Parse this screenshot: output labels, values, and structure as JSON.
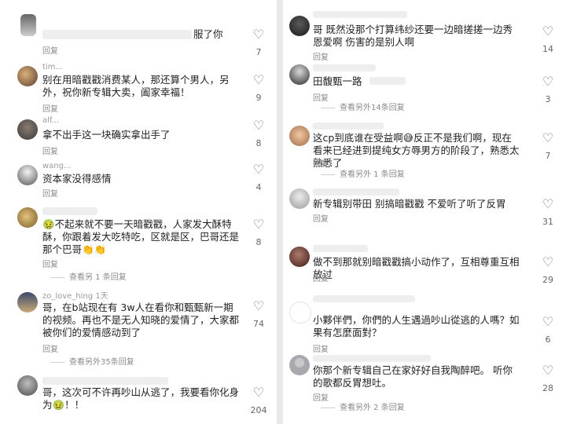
{
  "labels": {
    "reply": "回复",
    "heart_glyph": "♡"
  },
  "left_comments": [
    {
      "username": "",
      "text": "服了你",
      "likes": "7",
      "more": ""
    },
    {
      "username": "tim...",
      "text": "别在用暗戳戳消费某人，那还算个男人，另外，祝你新专辑大卖，阖家幸福！",
      "likes": "9",
      "more": ""
    },
    {
      "username": "alf...",
      "text": "拿不出手这一块确实拿出手了",
      "likes": "8",
      "more": ""
    },
    {
      "username": "wang...",
      "text": "资本家没得感情",
      "likes": "4",
      "more": ""
    },
    {
      "username": "",
      "text": "🤢不起来就不要一天暗戳戳，人家发大酥特酥，你跟着发大吃特吃，区就是区，巴哥还是那个巴哥👏👏",
      "likes": "8",
      "more": "查看另 1 条回复"
    },
    {
      "username": "zo_love_hing 1天",
      "text": "哥，在b站现在有 3w人在看你和甄甄新一期的视频。再也不是无人知晓的爱情了，大家都被你们的爱情感动到了",
      "likes": "74",
      "more": "查看另外35条回复"
    },
    {
      "username": "",
      "text": "哥，这次可不许再吵山从逃了，我要看你化身为🤢！！",
      "likes": "204",
      "more": ""
    }
  ],
  "right_comments": [
    {
      "username": "",
      "text": "哥 既然没那个打算纬纱还要一边暗搓搓一边秀恩爱啊 伤害的是别人啊",
      "likes": "14",
      "more": ""
    },
    {
      "username": "",
      "text": "田馥甄一路",
      "likes": "3",
      "more": "查看另外14条回复"
    },
    {
      "username": "",
      "text": "这cp到底谁在受益啊😅反正不是我们啊，现在看来已经进到提纯女方辱男方的阶段了，熟悉太熟悉了",
      "likes": "7",
      "more": "查看另外 1 条回复"
    },
    {
      "username": "",
      "text": "新专辑别带田 别搞暗戳戳 不爱听了听了反胃",
      "likes": "31",
      "more": ""
    },
    {
      "username": "",
      "text": "做不到那就别暗戳戳搞小动作了，互相尊重互相放过",
      "likes": "29",
      "more": ""
    },
    {
      "username": "",
      "text": "小夥伴們，你們的人生遇過吵山從逃的人嗎？如果有怎麼面對？",
      "likes": "6",
      "more": ""
    },
    {
      "username": "",
      "text": "你那个新专辑自己在家好好自我陶醉吧。 听你的歌都反胃想吐。",
      "likes": "28",
      "more": "查看另外 2 条回复"
    }
  ]
}
